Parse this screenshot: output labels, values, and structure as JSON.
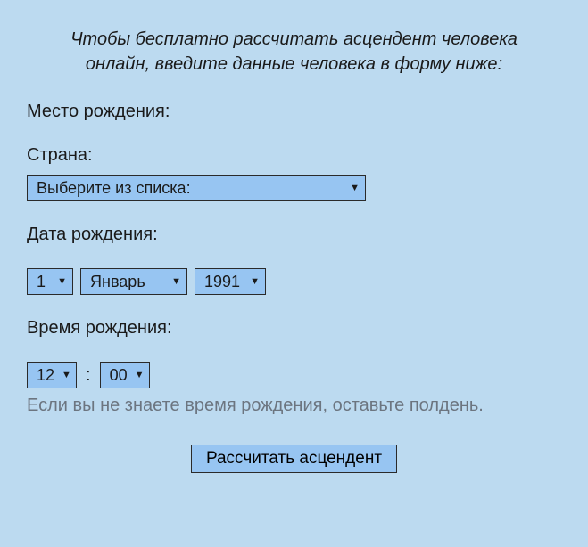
{
  "intro": "Чтобы бесплатно рассчитать асцендент человека онлайн, введите данные человека в форму ниже:",
  "birthplace": {
    "label": "Место рождения:"
  },
  "country": {
    "label": "Страна:",
    "selected": "Выберите из списка:"
  },
  "birthdate": {
    "label": "Дата рождения:",
    "day": "1",
    "month": "Январь",
    "year": "1991"
  },
  "birthtime": {
    "label": "Время рождения:",
    "hour": "12",
    "minute": "00",
    "note": "Если вы не знаете время рождения, оставьте полдень."
  },
  "submit": "Рассчитать асцендент"
}
